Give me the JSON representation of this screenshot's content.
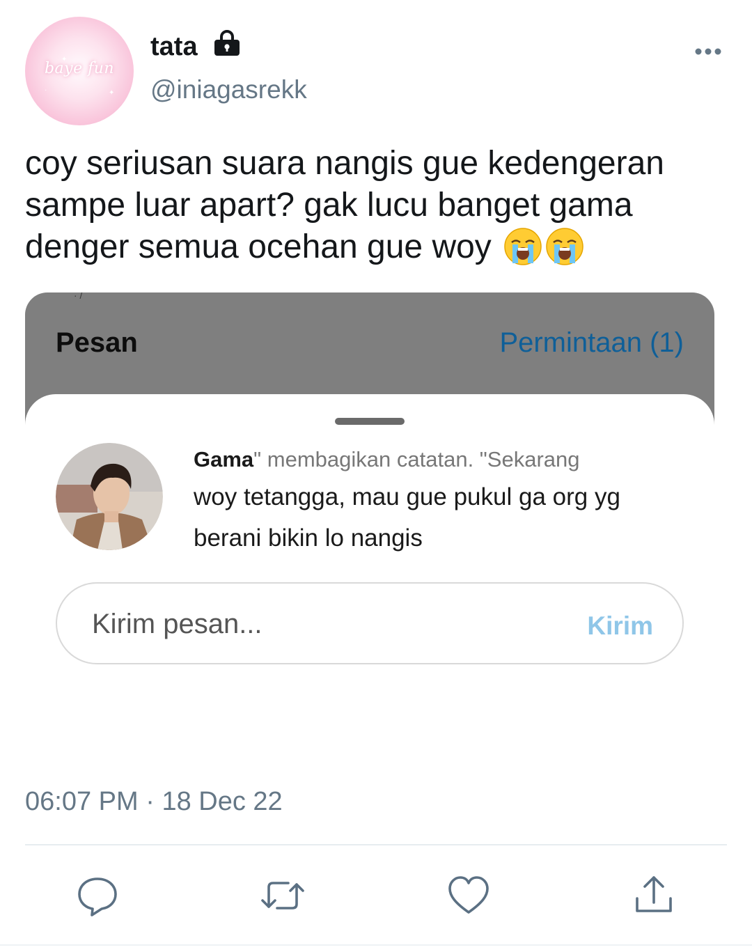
{
  "author": {
    "avatar_text": "baye fun",
    "display_name": "tata",
    "handle": "@iniagasrekk",
    "locked_icon": "lock-icon"
  },
  "tweet": {
    "text": "coy seriusan suara nangis gue kedengeran sampe luar apart? gak lucu banget gama denger semua ocehan gue woy",
    "emojis": [
      "loudly-crying-face",
      "loudly-crying-face"
    ]
  },
  "media": {
    "header_title": "Pesan",
    "requests_link": "Permintaan (1)",
    "note": {
      "sender": "Gama",
      "action_text": "\" membagikan catatan. \"Sekarang",
      "body": "woy tetangga, mau gue pukul ga org yg berani bikin lo nangis"
    },
    "input": {
      "placeholder": "Kirim pesan...",
      "send_label": "Kirim"
    }
  },
  "meta": {
    "time": "06:07 PM",
    "separator": "·",
    "date": "18 Dec 22"
  },
  "actions": [
    "reply-icon",
    "retweet-icon",
    "like-icon",
    "share-icon"
  ],
  "colors": {
    "link_blue": "#0f5f98",
    "send_blue": "#8fc6e8",
    "secondary_text": "#657786",
    "action_icon": "#5b7083"
  }
}
